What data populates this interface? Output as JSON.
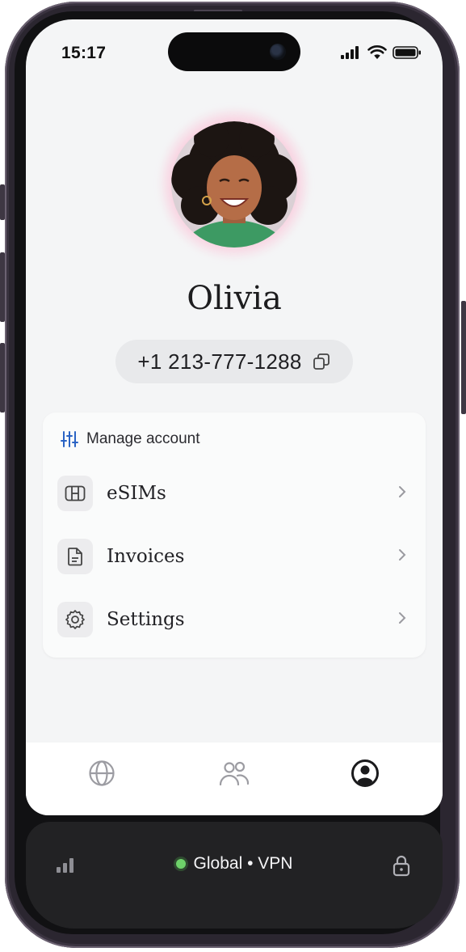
{
  "status_bar": {
    "time": "15:17"
  },
  "profile": {
    "name": "Olivia",
    "phone_number": "+1 213-777-1288"
  },
  "account_card": {
    "title": "Manage account",
    "items": [
      {
        "label": "eSIMs",
        "icon": "sim-card-icon"
      },
      {
        "label": "Invoices",
        "icon": "document-icon"
      },
      {
        "label": "Settings",
        "icon": "gear-icon"
      }
    ]
  },
  "tab_bar": {
    "tabs": [
      {
        "icon": "globe-icon",
        "active": false
      },
      {
        "icon": "people-icon",
        "active": false
      },
      {
        "icon": "profile-icon",
        "active": true
      }
    ]
  },
  "vpn": {
    "status_text": "Global • VPN",
    "status_color": "#6ed26a"
  },
  "colors": {
    "screen_background": "#f4f5f6",
    "card_background": "#fafbfb",
    "accent_blue": "#2a63c4",
    "vpn_bar": "#222224"
  }
}
